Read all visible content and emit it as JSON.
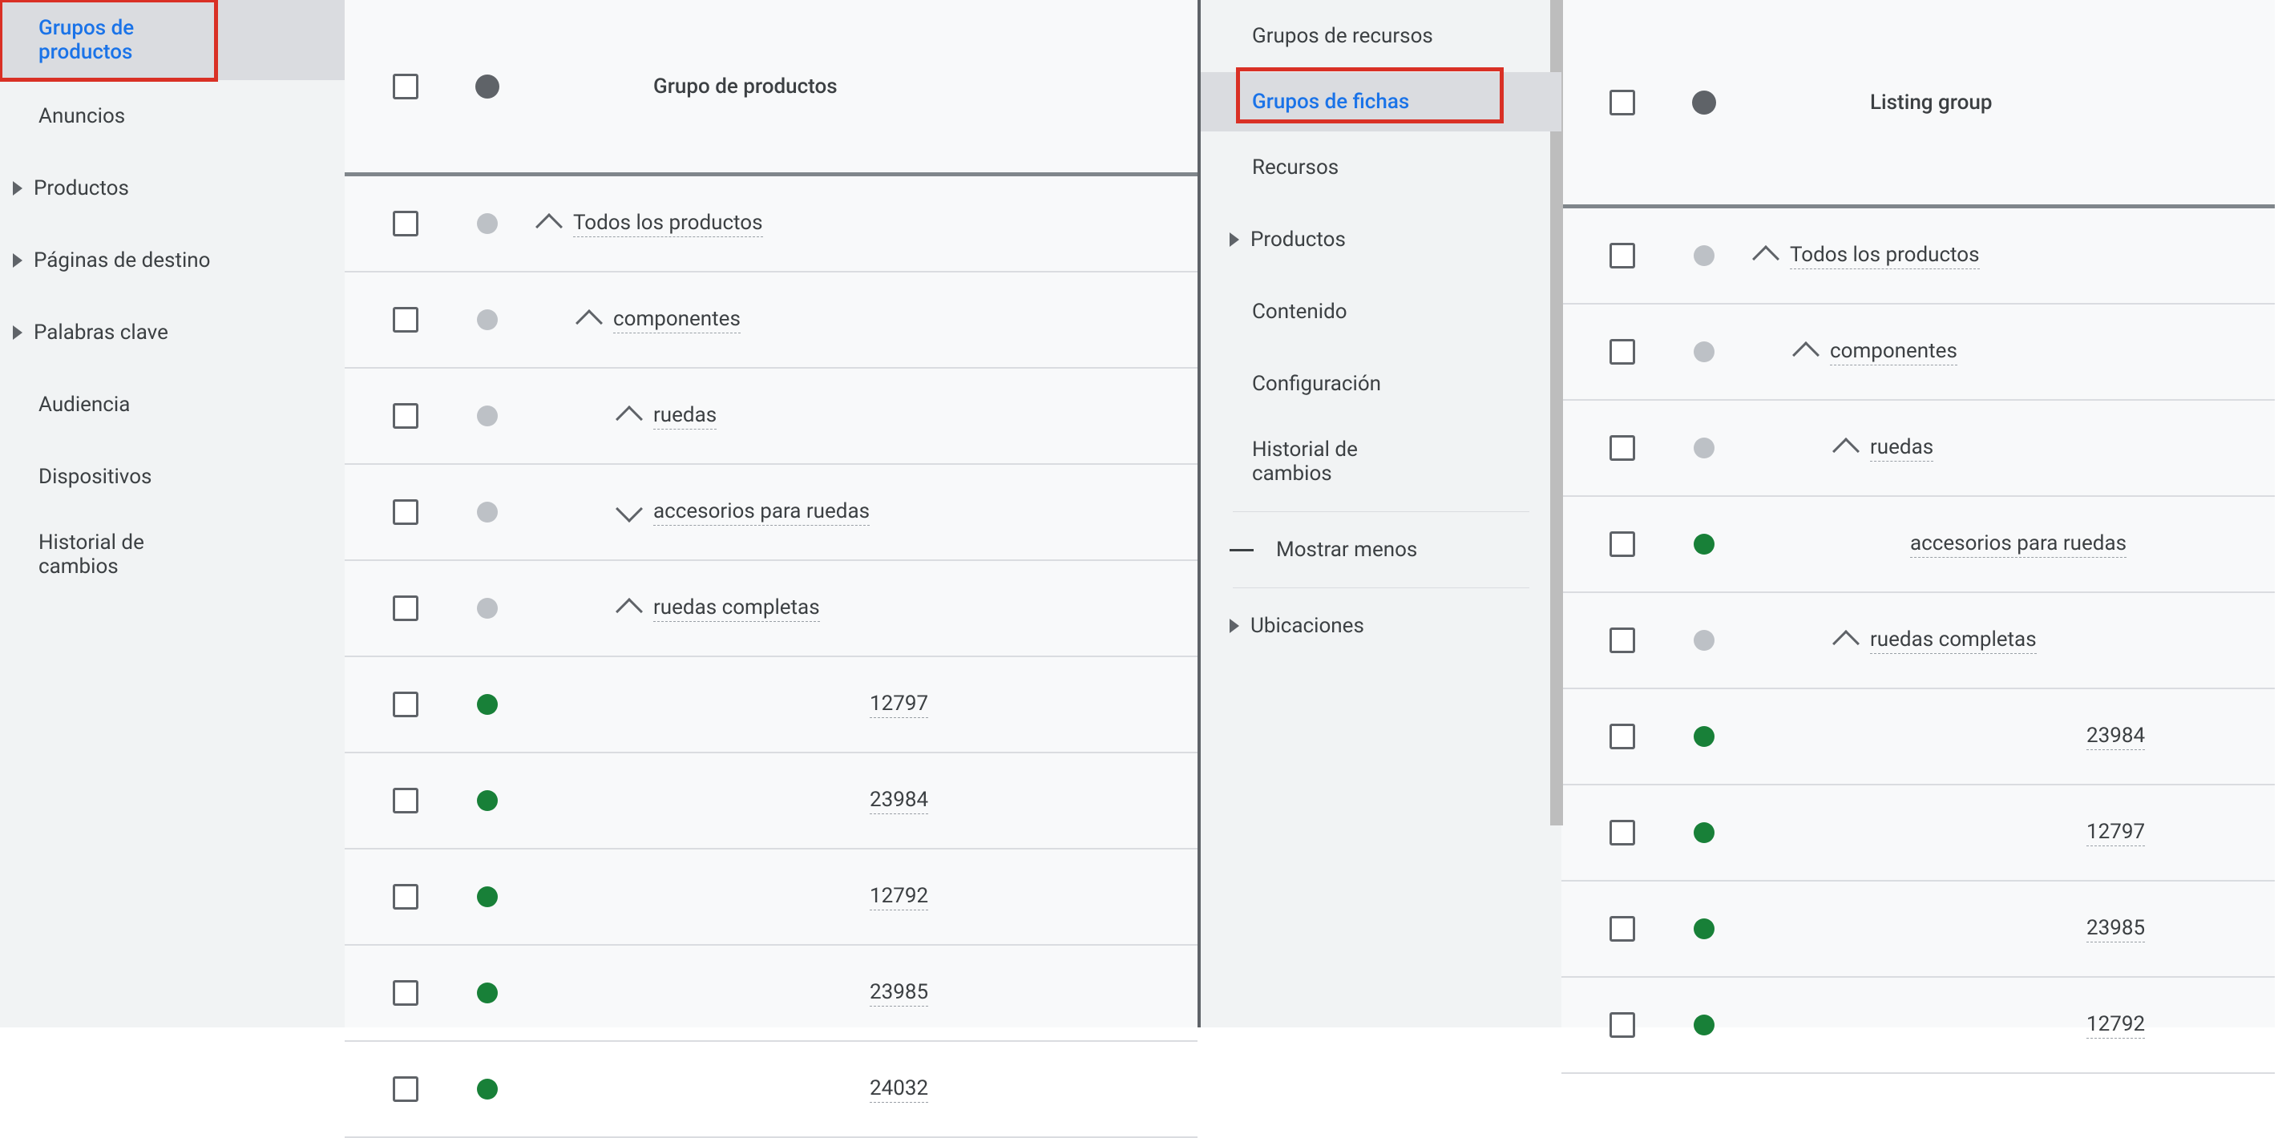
{
  "left": {
    "sidebar": [
      {
        "label": "Grupos de productos",
        "selected": true,
        "expandable": false
      },
      {
        "label": "Anuncios",
        "selected": false,
        "expandable": false
      },
      {
        "label": "Productos",
        "selected": false,
        "expandable": true
      },
      {
        "label": "Páginas de destino",
        "selected": false,
        "expandable": true
      },
      {
        "label": "Palabras clave",
        "selected": false,
        "expandable": true
      },
      {
        "label": "Audiencia",
        "selected": false,
        "expandable": false
      },
      {
        "label": "Dispositivos",
        "selected": false,
        "expandable": false
      },
      {
        "label": "Historial de cambios",
        "selected": false,
        "expandable": false
      }
    ],
    "header": "Grupo de productos",
    "rows": [
      {
        "label": "Todos los productos",
        "dot": "gray",
        "caret": "up",
        "indent": 0
      },
      {
        "label": "componentes",
        "dot": "gray",
        "caret": "up",
        "indent": 1
      },
      {
        "label": "ruedas",
        "dot": "gray",
        "caret": "up",
        "indent": 2
      },
      {
        "label": "accesorios para ruedas",
        "dot": "gray",
        "caret": "down",
        "indent": 2
      },
      {
        "label": "ruedas completas",
        "dot": "gray",
        "caret": "up",
        "indent": 2
      },
      {
        "label": "12797",
        "dot": "green",
        "caret": "",
        "indent": 4
      },
      {
        "label": "23984",
        "dot": "green",
        "caret": "",
        "indent": 4
      },
      {
        "label": "12792",
        "dot": "green",
        "caret": "",
        "indent": 4
      },
      {
        "label": "23985",
        "dot": "green",
        "caret": "",
        "indent": 4
      },
      {
        "label": "24032",
        "dot": "green",
        "caret": "",
        "indent": 4
      }
    ]
  },
  "right": {
    "sidebar": [
      {
        "label": "Grupos de recursos",
        "selected": false,
        "expandable": false
      },
      {
        "label": "Grupos de fichas",
        "selected": true,
        "expandable": false
      },
      {
        "label": "Recursos",
        "selected": false,
        "expandable": false
      },
      {
        "label": "Productos",
        "selected": false,
        "expandable": true
      },
      {
        "label": "Contenido",
        "selected": false,
        "expandable": false
      },
      {
        "label": "Configuración",
        "selected": false,
        "expandable": false
      },
      {
        "label": "Historial de cambios",
        "selected": false,
        "expandable": false
      }
    ],
    "show_less": "Mostrar menos",
    "footer_items": [
      {
        "label": "Ubicaciones",
        "expandable": true
      }
    ],
    "header": "Listing group",
    "rows": [
      {
        "label": "Todos los productos",
        "dot": "gray",
        "caret": "up",
        "indent": 0
      },
      {
        "label": "componentes",
        "dot": "gray",
        "caret": "up",
        "indent": 1
      },
      {
        "label": "ruedas",
        "dot": "gray",
        "caret": "up",
        "indent": 2
      },
      {
        "label": "accesorios para ruedas",
        "dot": "green",
        "caret": "",
        "indent": 3
      },
      {
        "label": "ruedas completas",
        "dot": "gray",
        "caret": "up",
        "indent": 2
      },
      {
        "label": "23984",
        "dot": "green",
        "caret": "",
        "indent": 4
      },
      {
        "label": "12797",
        "dot": "green",
        "caret": "",
        "indent": 4
      },
      {
        "label": "23985",
        "dot": "green",
        "caret": "",
        "indent": 4
      },
      {
        "label": "12792",
        "dot": "green",
        "caret": "",
        "indent": 4
      }
    ]
  }
}
